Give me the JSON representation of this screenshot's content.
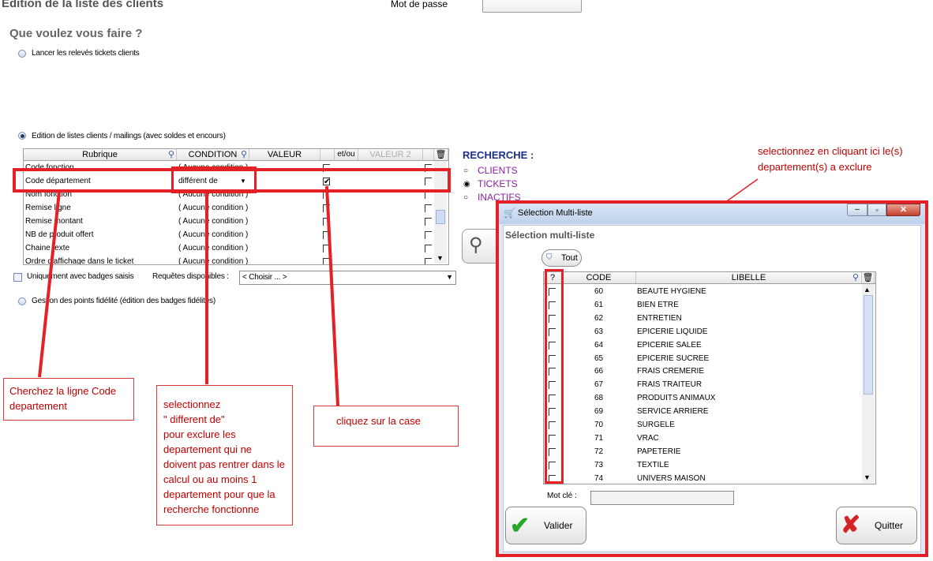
{
  "page": {
    "title": "Edition de la liste des clients",
    "password_label": "Mot de passe",
    "question": "Que voulez vous faire ?",
    "option1": "Lancer les relevés tickets clients",
    "option2": "Edition de listes clients / mailings (avec soldes et encours)",
    "option3": "Gestion des points fidélité (édition des badges fidélités)"
  },
  "grid": {
    "headers": [
      "Rubrique",
      "CONDITION",
      "VALEUR",
      "et/ou",
      "VALEUR 2"
    ],
    "rows": [
      {
        "rubrique": "Code fonction",
        "condition": "( Aucune condition )",
        "checked": false
      },
      {
        "rubrique": "Code département",
        "condition": "différent de",
        "checked": true
      },
      {
        "rubrique": "Nom fonction",
        "condition": "( Aucune condition )",
        "checked": false
      },
      {
        "rubrique": "Remise ligne",
        "condition": "( Aucune condition )",
        "checked": false
      },
      {
        "rubrique": "Remise montant",
        "condition": "( Aucune condition )",
        "checked": false
      },
      {
        "rubrique": "NB de produit offert",
        "condition": "( Aucune condition )",
        "checked": false
      },
      {
        "rubrique": "Chaine texte",
        "condition": "( Aucune condition )",
        "checked": false
      },
      {
        "rubrique": "Ordre d'affichage dans le ticket",
        "condition": "( Aucune condition )",
        "checked": false
      }
    ]
  },
  "recherche": {
    "title": "RECHERCHE :",
    "options": [
      "CLIENTS",
      "TICKETS",
      "INACTIFS"
    ],
    "selected": "TICKETS"
  },
  "filters": {
    "badges_label": "Uniquement avec badges saisis",
    "requetes_label": "Requêtes disponibles :",
    "requetes_value": "< Choisir ... >"
  },
  "annotations": {
    "top_right": "selectionnez en cliquant ici le(s) departement(s) a exclure",
    "note1": "Cherchez la ligne Code departement",
    "note2": "selectionnez\n\" different de\"\n pour exclure les departement qui ne doivent pas rentrer dans le calcul ou au moins 1 departement pour que la recherche fonctionne",
    "note3": "cliquez sur la case"
  },
  "dialog": {
    "window_title": "Sélection Multi-liste",
    "heading": "Sélection multi-liste",
    "tout_label": "Tout",
    "col_q": "?",
    "col_code": "CODE",
    "col_libelle": "LIBELLE",
    "items": [
      {
        "code": "60",
        "libelle": "BEAUTE HYGIENE"
      },
      {
        "code": "61",
        "libelle": "BIEN ETRE"
      },
      {
        "code": "62",
        "libelle": "ENTRETIEN"
      },
      {
        "code": "63",
        "libelle": "EPICERIE LIQUIDE"
      },
      {
        "code": "64",
        "libelle": "EPICERIE SALEE"
      },
      {
        "code": "65",
        "libelle": "EPICERIE SUCREE"
      },
      {
        "code": "66",
        "libelle": "FRAIS CREMERIE"
      },
      {
        "code": "67",
        "libelle": "FRAIS TRAITEUR"
      },
      {
        "code": "68",
        "libelle": "PRODUITS ANIMAUX"
      },
      {
        "code": "69",
        "libelle": "SERVICE ARRIERE"
      },
      {
        "code": "70",
        "libelle": "SURGELE"
      },
      {
        "code": "71",
        "libelle": "VRAC"
      },
      {
        "code": "72",
        "libelle": "PAPETERIE"
      },
      {
        "code": "73",
        "libelle": "TEXTILE"
      },
      {
        "code": "74",
        "libelle": "UNIVERS MAISON"
      }
    ],
    "motcle_label": "Mot clé :",
    "valider_label": "Valider",
    "quitter_label": "Quitter"
  },
  "colors": {
    "annotation_red": "#e52027",
    "recherche_blue": "#1b2f86",
    "recherche_purple": "#8b1f9e"
  }
}
